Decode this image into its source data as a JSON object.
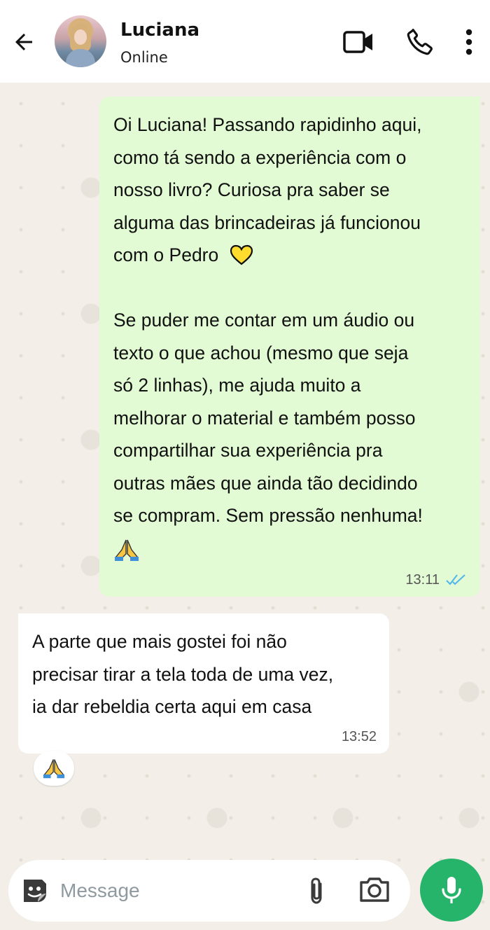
{
  "header": {
    "contact_name": "Luciana",
    "status": "Online",
    "icons": {
      "back": "arrow-left-icon",
      "video": "video-camera-icon",
      "call": "phone-icon",
      "menu": "more-vertical-icon"
    }
  },
  "messages": [
    {
      "direction": "outgoing",
      "lines": [
        "Oi Luciana! Passando rapidinho aqui,",
        "como tá sendo a experiência com o",
        "nosso livro? Curiosa pra saber se",
        "alguma das brincadeiras já funcionou",
        "com o Pedro",
        "",
        "Se puder me contar em um áudio ou",
        "texto o que achou (mesmo que seja",
        "só 2 linhas), me ajuda muito a",
        "melhorar o material e também posso",
        "compartilhar sua experiência pra",
        "outras mães que ainda tão decidindo",
        "se compram. Sem pressão nenhuma!"
      ],
      "emojis": [
        "yellow-heart",
        "folded-hands"
      ],
      "time": "13:11",
      "status": "read"
    },
    {
      "direction": "incoming",
      "lines": [
        "A parte que mais gostei foi não",
        "precisar tirar a tela toda de uma vez,",
        "ia dar rebeldia certa aqui em casa"
      ],
      "time": "13:52",
      "reaction": "folded-hands"
    }
  ],
  "composer": {
    "placeholder": "Message",
    "icons": {
      "sticker": "sticker-icon",
      "attach": "paperclip-icon",
      "camera": "camera-icon",
      "mic": "microphone-icon"
    }
  },
  "colors": {
    "outgoing_bubble": "#e2fbd4",
    "incoming_bubble": "#ffffff",
    "chat_background": "#f3efe8",
    "accent_green": "#25b46a",
    "read_ticks": "#4fb6ec"
  }
}
